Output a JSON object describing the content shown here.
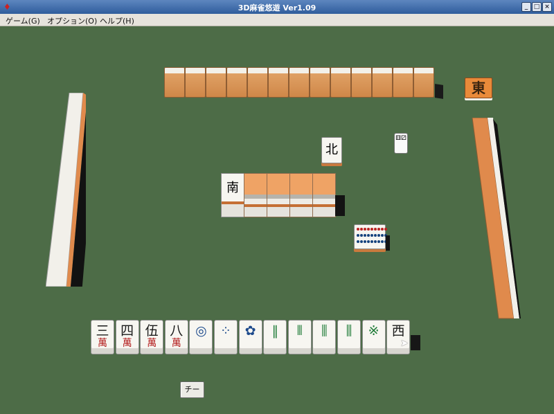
{
  "window": {
    "title": "3D麻雀悠遊 Ver1.09",
    "app_icon": "app-icon",
    "minimize_glyph": "_",
    "maximize_glyph": "□",
    "close_glyph": "×"
  },
  "menu": [
    {
      "label": "ゲーム(G)"
    },
    {
      "label": "オプション(O)"
    },
    {
      "label": "ヘルプ(H)"
    }
  ],
  "table": {
    "round_wind": "東",
    "discard_top": "北",
    "meld_tile": "南",
    "chi_button_label": "チー",
    "dice_face": "⚅⚂"
  },
  "hand": [
    {
      "top": "三",
      "sub": "萬",
      "suit": "man"
    },
    {
      "top": "四",
      "sub": "萬",
      "suit": "man"
    },
    {
      "top": "伍",
      "sub": "萬",
      "suit": "man"
    },
    {
      "top": "八",
      "sub": "萬",
      "suit": "man"
    },
    {
      "top": "◎",
      "sub": "",
      "suit": "pin"
    },
    {
      "top": "⁘",
      "sub": "",
      "suit": "pin"
    },
    {
      "top": "✿",
      "sub": "",
      "suit": "pin"
    },
    {
      "top": "‖",
      "sub": "",
      "suit": "sou"
    },
    {
      "top": "⫴",
      "sub": "",
      "suit": "sou"
    },
    {
      "top": "⫼",
      "sub": "",
      "suit": "sou"
    },
    {
      "top": "⫼",
      "sub": "",
      "suit": "sou"
    },
    {
      "top": "※",
      "sub": "",
      "suit": "sou"
    },
    {
      "top": "西",
      "sub": "",
      "suit": "honor"
    }
  ],
  "colors": {
    "felt": "#4d6c47",
    "tile_back": "#e0a165",
    "tile_face": "#f7f6f1",
    "man_red": "#b21b1b",
    "pin_blue": "#1d4a8c",
    "sou_green": "#1d7a36"
  }
}
